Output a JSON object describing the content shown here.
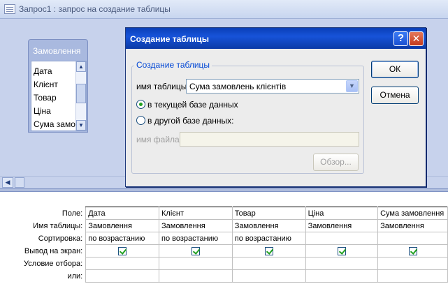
{
  "window": {
    "title": "Запрос1 : запрос на создание таблицы"
  },
  "field_list": {
    "title": "Замовлення",
    "items": [
      "Дата",
      "Клієнт",
      "Товар",
      "Ціна",
      "Сума замовлення"
    ]
  },
  "dialog": {
    "title": "Создание таблицы",
    "group_label": "Создание таблицы",
    "table_name_label": "имя таблицы:",
    "table_name_value": "Сума замовлень клієнтів",
    "radio_current": "в текущей базе данных",
    "radio_other": "в другой базе данных:",
    "radio_selected": "current",
    "file_name_label": "имя файла:",
    "file_name_value": "",
    "ok_label": "ОК",
    "cancel_label": "Отмена",
    "browse_label": "Обзор..."
  },
  "grid": {
    "row_headers": [
      "Поле:",
      "Имя таблицы:",
      "Сортировка:",
      "Вывод на экран:",
      "Условие отбора:",
      "или:"
    ],
    "columns": [
      {
        "field": "Дата",
        "table": "Замовлення",
        "sort": "по возрастанию",
        "show": true,
        "criteria": "",
        "or": ""
      },
      {
        "field": "Клієнт",
        "table": "Замовлення",
        "sort": "по возрастанию",
        "show": true,
        "criteria": "",
        "or": ""
      },
      {
        "field": "Товар",
        "table": "Замовлення",
        "sort": "по возрастанию",
        "show": true,
        "criteria": "",
        "or": ""
      },
      {
        "field": "Ціна",
        "table": "Замовлення",
        "sort": "",
        "show": true,
        "criteria": "",
        "or": ""
      },
      {
        "field": "Сума замовлення",
        "table": "Замовлення",
        "sort": "",
        "show": true,
        "criteria": "",
        "or": ""
      }
    ]
  }
}
